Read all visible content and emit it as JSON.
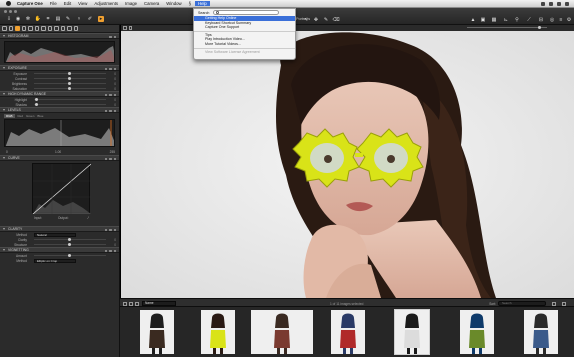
{
  "menubar": {
    "items": [
      "Capture One",
      "File",
      "Edit",
      "View",
      "Adjustments",
      "Image",
      "Camera",
      "Window",
      "Help"
    ],
    "active": "Help"
  },
  "help_menu": {
    "search_label": "Search",
    "items": [
      {
        "label": "Getting Help Online",
        "highlighted": true
      },
      {
        "label": "Keyboard Shortcut Summary"
      },
      {
        "label": "Capture One Support"
      },
      {
        "separator": true
      },
      {
        "label": "Tips"
      },
      {
        "label": "Play Introduction Video..."
      },
      {
        "label": "More Tutorial Videos..."
      },
      {
        "separator": true
      },
      {
        "label": "View Software License Agreement",
        "disabled": true
      }
    ]
  },
  "toolbar": {
    "title": "Portraits",
    "left_tools": [
      "import-icon",
      "camera-icon",
      "gear-icon",
      "hand-icon",
      "crop-icon",
      "straighten-icon",
      "clone-icon",
      "eyedropper-icon",
      "annotate-icon"
    ],
    "right_tools": [
      "ruler-icon",
      "grid-icon",
      "exposure-warning-icon",
      "focus-mask-icon",
      "proof-icon",
      "compare-icon",
      "compare-slider-icon",
      "variant-icon",
      "eye-icon",
      "process-icon",
      "settings-icon"
    ]
  },
  "sidebar": {
    "exposure_panel": {
      "title": "Exposure",
      "rows": [
        {
          "label": "Exposure",
          "value": "0"
        },
        {
          "label": "Contrast",
          "value": "0"
        },
        {
          "label": "Brightness",
          "value": "0"
        },
        {
          "label": "Saturation",
          "value": "0"
        }
      ]
    },
    "hdr_panel": {
      "title": "High Dynamic Range",
      "rows": [
        {
          "label": "Highlight",
          "value": "0"
        },
        {
          "label": "Shadow",
          "value": "0"
        }
      ]
    },
    "levels_panel": {
      "title": "Levels",
      "tabs": [
        "RGB",
        "Red",
        "Green",
        "Blue"
      ],
      "active_tab": "RGB",
      "left_value": "0",
      "mid_value": "1.00",
      "right_value": "255"
    },
    "curve_panel": {
      "title": "Curve",
      "input_label": "Input:",
      "output_label": "Output:"
    },
    "clarity_panel": {
      "title": "Clarity",
      "method_label": "Method",
      "method_value": "Natural",
      "rows": [
        {
          "label": "Clarity",
          "value": "0"
        },
        {
          "label": "Structure",
          "value": "0"
        }
      ]
    },
    "vignetting_panel": {
      "title": "Vignetting",
      "amount_label": "Amount",
      "method_label": "Method",
      "method_value": "Elliptic on Crop"
    }
  },
  "filmbar": {
    "album": "Name",
    "info": "1 of 11 images selected",
    "sort_label": "Sort:",
    "search_placeholder": "Search"
  },
  "thumbnails": [
    {
      "selected": false
    },
    {
      "selected": false
    },
    {
      "selected": false
    },
    {
      "selected": false
    },
    {
      "selected": true
    },
    {
      "selected": false
    },
    {
      "selected": false
    }
  ]
}
